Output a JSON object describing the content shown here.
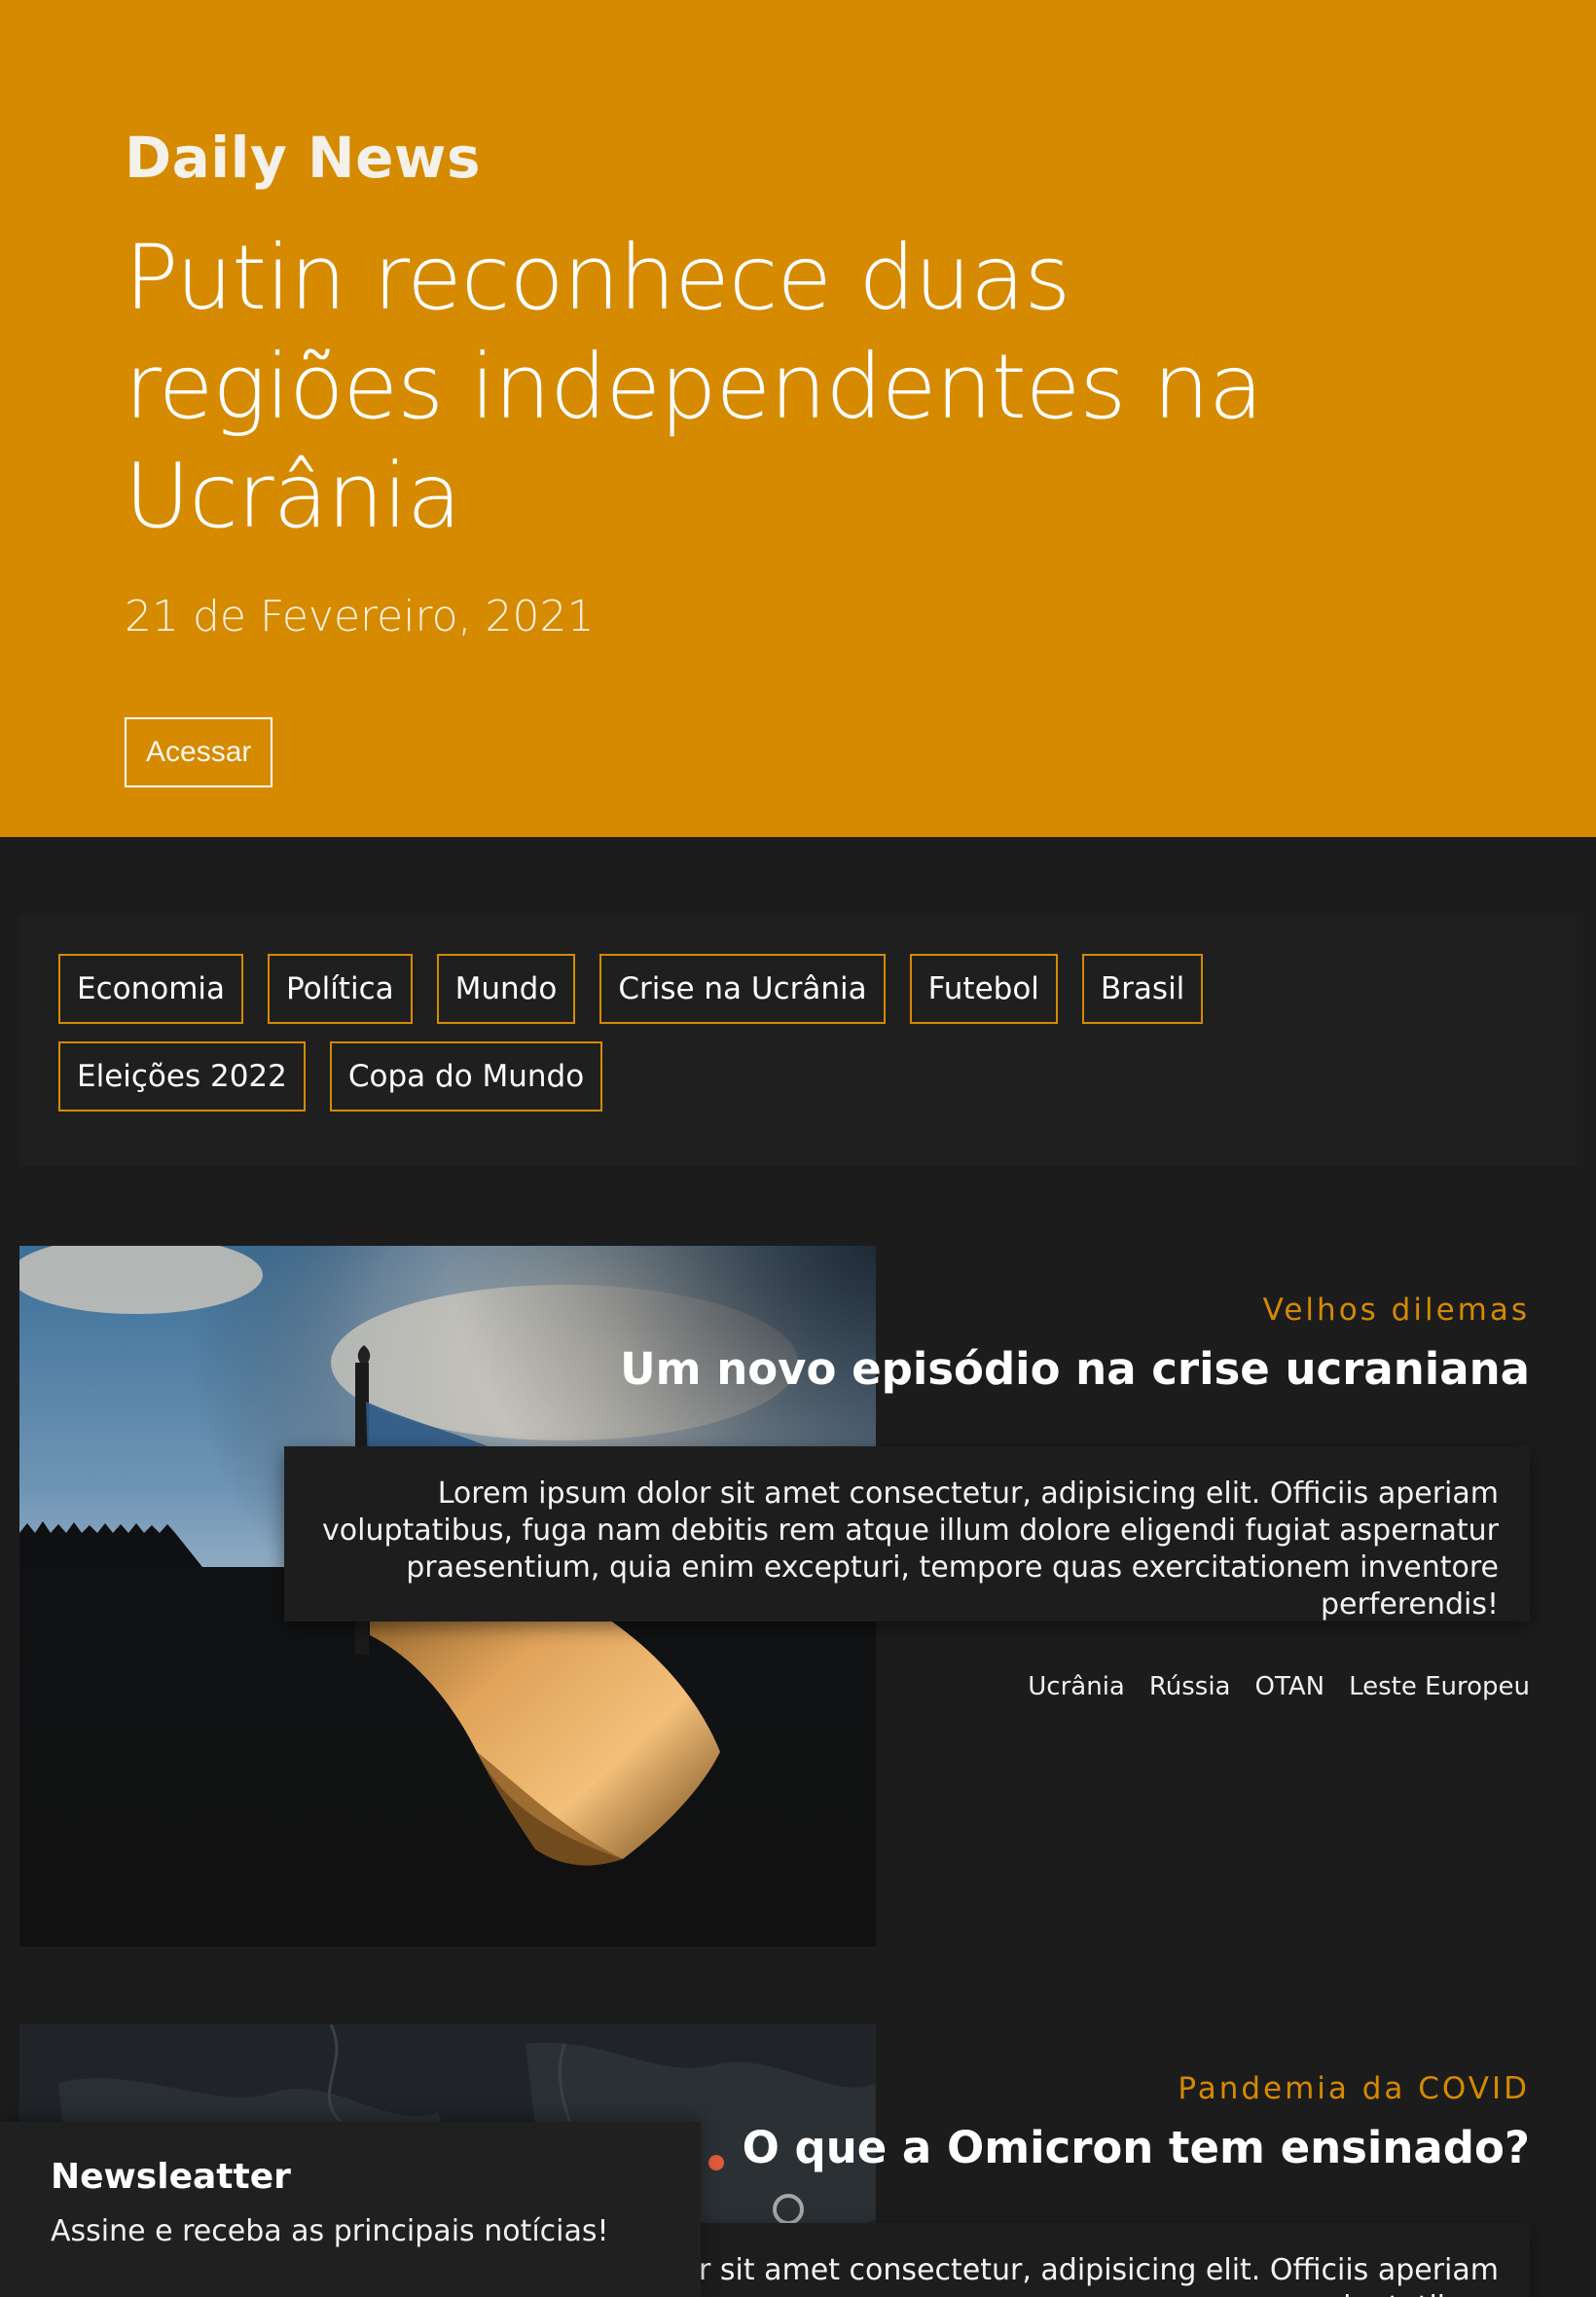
{
  "hero": {
    "brand": "Daily News",
    "headline": "Putin reconhece duas regiões independentes na Ucrânia",
    "date": "21 de Fevereiro, 2021",
    "cta": "Acessar"
  },
  "categories": [
    "Economia",
    "Política",
    "Mundo",
    "Crise na Ucrânia",
    "Futebol",
    "Brasil",
    "Eleições 2022",
    "Copa do Mundo"
  ],
  "articles": [
    {
      "kicker": "Velhos dilemas",
      "title": "Um novo episódio na crise ucraniana",
      "excerpt": "Lorem ipsum dolor sit amet consectetur, adipisicing elit. Officiis aperiam voluptatibus, fuga nam debitis rem atque illum dolore eligendi fugiat aspernatur praesentium, quia enim excepturi, tempore quas exercitationem inventore perferendis!",
      "tags": [
        "Ucrânia",
        "Rússia",
        "OTAN",
        "Leste Europeu"
      ]
    },
    {
      "kicker": "Pandemia da COVID",
      "title": "O que a Omicron tem ensinado?",
      "excerpt": "Lorem ipsum dolor sit amet consectetur, adipisicing elit. Officiis aperiam voluptatibus,"
    }
  ],
  "newsletter": {
    "title": "Newsleatter",
    "text": "Assine e receba as principais notícias!"
  },
  "colors": {
    "accent": "#d58a00",
    "background": "#1c1c1d",
    "panel": "#1f1f20"
  }
}
